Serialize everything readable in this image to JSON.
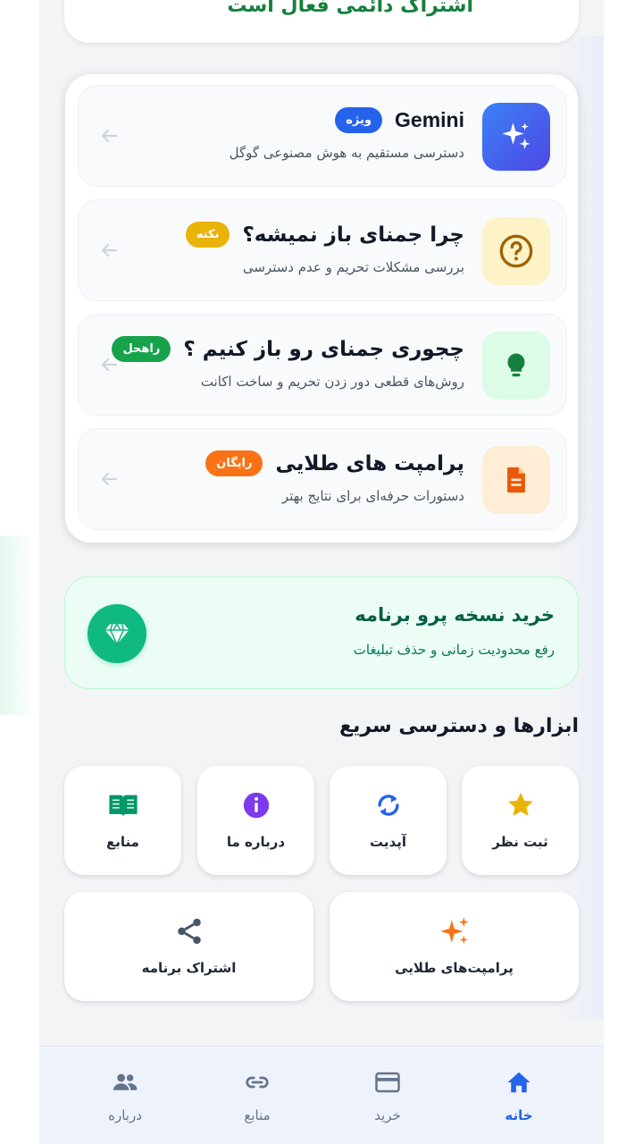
{
  "top_card": {
    "text": "اشتراک دائمی فعال است"
  },
  "items": [
    {
      "title": "Gemini",
      "badge": "ویژه",
      "badge_color": "#2563eb",
      "desc": "دسترسی مستقیم به هوش مصنوعی گوگل",
      "icon": "sparkle-icon"
    },
    {
      "title": "چرا جمنای باز نمیشه؟",
      "badge": "نکته",
      "badge_color": "#eab308",
      "desc": "بررسی مشکلات تحریم و عدم دسترسی",
      "icon": "question-icon"
    },
    {
      "title": "چجوری جمنای رو باز کنیم ؟",
      "badge": "راهحل",
      "badge_color": "#16a34a",
      "desc": "روش‌های قطعی دور زدن تحریم و ساخت اکانت",
      "icon": "lightbulb-icon"
    },
    {
      "title": "پرامپت های طلایی",
      "badge": "رایگان",
      "badge_color": "#f97316",
      "desc": "دستورات حرفه‌ای برای نتایج بهتر",
      "icon": "document-icon"
    }
  ],
  "pro": {
    "title": "خرید نسخه پرو برنامه",
    "desc": "رفع محدودیت زمانی و حذف تبلیغات",
    "icon": "diamond-icon"
  },
  "section_title": "ابزارها و دسترسی سریع",
  "tools": [
    {
      "label": "ثبت نظر",
      "icon": "star-icon"
    },
    {
      "label": "آپدیت",
      "icon": "refresh-icon"
    },
    {
      "label": "درباره ما",
      "icon": "info-icon"
    },
    {
      "label": "منابع",
      "icon": "book-icon"
    },
    {
      "label": "پرامپت‌های طلایی",
      "icon": "sparkles-icon"
    },
    {
      "label": "اشتراک برنامه",
      "icon": "share-icon"
    }
  ],
  "nav": [
    {
      "label": "خانه",
      "icon": "home-icon",
      "active": true
    },
    {
      "label": "خرید",
      "icon": "card-icon",
      "active": false
    },
    {
      "label": "منابع",
      "icon": "link-icon",
      "active": false
    },
    {
      "label": "درباره",
      "icon": "people-icon",
      "active": false
    }
  ]
}
